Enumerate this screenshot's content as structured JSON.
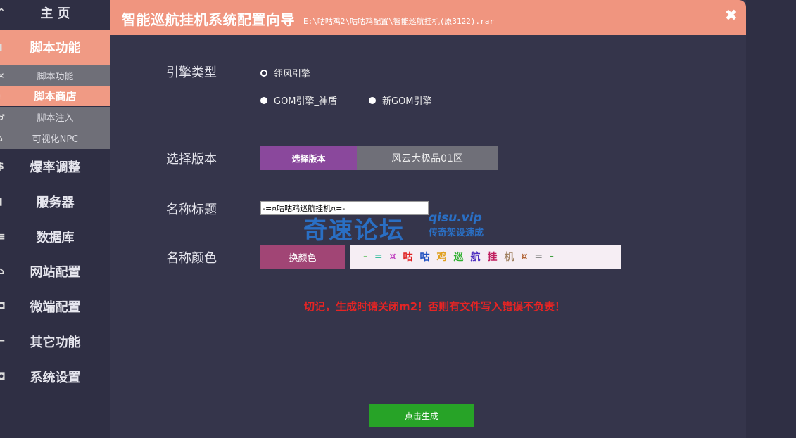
{
  "sidebar": {
    "items": [
      {
        "label": "主 页",
        "icon": "home-icon",
        "glyph": "⌃"
      },
      {
        "label": "脚本功能",
        "icon": "script-icon",
        "glyph": "▮"
      },
      {
        "label": "爆率调整",
        "icon": "rate-icon",
        "glyph": "$"
      },
      {
        "label": "服务器",
        "icon": "server-icon",
        "glyph": "▮"
      },
      {
        "label": "数据库",
        "icon": "database-icon",
        "glyph": "≡"
      },
      {
        "label": "网站配置",
        "icon": "website-icon",
        "glyph": "⌂"
      },
      {
        "label": "微端配置",
        "icon": "microclient-icon",
        "glyph": "◘"
      },
      {
        "label": "其它功能",
        "icon": "other-icon",
        "glyph": "⌐"
      },
      {
        "label": "系统设置",
        "icon": "settings-icon",
        "glyph": "◘"
      }
    ],
    "sub_items": [
      {
        "label": "脚本功能",
        "icon": "close-icon",
        "glyph": "✕"
      },
      {
        "label": "脚本商店",
        "icon": "shop-icon",
        "glyph": "⁞"
      },
      {
        "label": "脚本注入",
        "icon": "inject-icon",
        "glyph": "♂"
      },
      {
        "label": "可视化NPC",
        "icon": "npc-icon",
        "glyph": "⌂"
      }
    ]
  },
  "dialog": {
    "title": "智能巡航挂机系统配置向导",
    "path": "E:\\咕咕鸡2\\咕咕鸡配置\\智能巡航挂机(原3122).rar",
    "close_glyph": "✖"
  },
  "engine": {
    "label": "引擎类型",
    "options": [
      "翎风引擎",
      "GOM引擎_神盾",
      "新GOM引擎"
    ]
  },
  "version": {
    "label": "选择版本",
    "button": "选择版本",
    "value": "风云大极品01区"
  },
  "name_title": {
    "label": "名称标题",
    "value": "-=¤咕咕鸡巡航挂机¤=-"
  },
  "name_color": {
    "label": "名称颜色",
    "button": "换颜色",
    "preview": [
      {
        "ch": "-",
        "color": "#7fc97f"
      },
      {
        "ch": "=",
        "color": "#3ac0a0"
      },
      {
        "ch": "¤",
        "color": "#c040c0"
      },
      {
        "ch": "咕",
        "color": "#e02020"
      },
      {
        "ch": "咕",
        "color": "#2050c0"
      },
      {
        "ch": "鸡",
        "color": "#e0a020"
      },
      {
        "ch": "巡",
        "color": "#30b030"
      },
      {
        "ch": "航",
        "color": "#5030c0"
      },
      {
        "ch": "挂",
        "color": "#c02060"
      },
      {
        "ch": "机",
        "color": "#a08060"
      },
      {
        "ch": "¤",
        "color": "#b06030"
      },
      {
        "ch": "=",
        "color": "#909090"
      },
      {
        "ch": "-",
        "color": "#40a040"
      }
    ]
  },
  "warning": "切记，生成时请关闭m2！否则有文件写入错误不负责！",
  "watermark": {
    "main": "奇速论坛",
    "site": "qisu.vip",
    "sub": "传奇架设速成"
  },
  "generate_button": "点击生成"
}
